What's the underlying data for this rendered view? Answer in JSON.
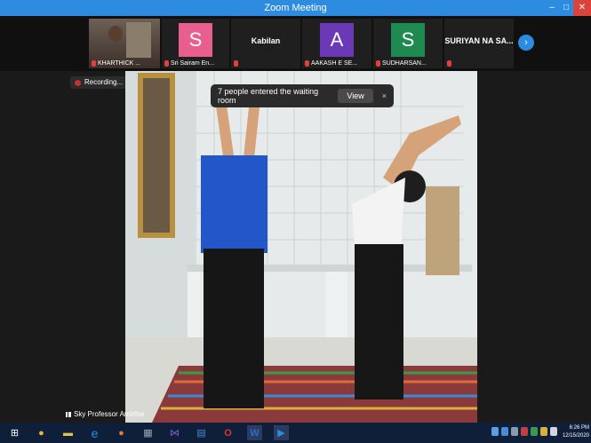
{
  "window": {
    "title": "Zoom Meeting",
    "controls": {
      "minimize": "–",
      "maximize": "□",
      "close": "✕"
    }
  },
  "participants": [
    {
      "label": "KHARTHICK ...",
      "type": "video"
    },
    {
      "label": "Sri Sairam En...",
      "initial": "S",
      "color": "#e85e8e"
    },
    {
      "label": "",
      "name": "Kabilan"
    },
    {
      "label": "AAKASH E SE...",
      "initial": "A",
      "color": "#6b39b6"
    },
    {
      "label": "SUDHARSAN...",
      "initial": "S",
      "color": "#1e8a4f"
    },
    {
      "label": "",
      "name": "SURIYAN NA SA..."
    }
  ],
  "next_arrow": "›",
  "recording": {
    "label": "Recording..."
  },
  "notification": {
    "message": "7 people entered the waiting room",
    "view_label": "View",
    "close_label": "×"
  },
  "active_speaker": {
    "name": "Sky Professor Amirtha"
  },
  "taskbar": {
    "items": [
      {
        "icon": "windows-start-icon",
        "glyph": "⊞",
        "color": "#ffffff"
      },
      {
        "icon": "chrome-icon",
        "glyph": "●",
        "color": "#e9b82f"
      },
      {
        "icon": "file-explorer-icon",
        "glyph": "▬",
        "color": "#e8c14a"
      },
      {
        "icon": "edge-icon",
        "glyph": "e",
        "color": "#2d8cdf"
      },
      {
        "icon": "firefox-icon",
        "glyph": "●",
        "color": "#e6772e"
      },
      {
        "icon": "app-grid-icon",
        "glyph": "▦",
        "color": "#9aa7b8"
      },
      {
        "icon": "visual-studio-icon",
        "glyph": "⋈",
        "color": "#8a5ad1"
      },
      {
        "icon": "app-icon",
        "glyph": "▤",
        "color": "#4a8ad8"
      },
      {
        "icon": "opera-icon",
        "glyph": "O",
        "color": "#e03030"
      },
      {
        "icon": "word-icon",
        "glyph": "W",
        "color": "#2b6cd4"
      },
      {
        "icon": "zoom-icon",
        "glyph": "▶",
        "color": "#2d8cdf"
      }
    ],
    "clock": {
      "time": "6:26 PM",
      "date": "12/15/2020"
    }
  }
}
